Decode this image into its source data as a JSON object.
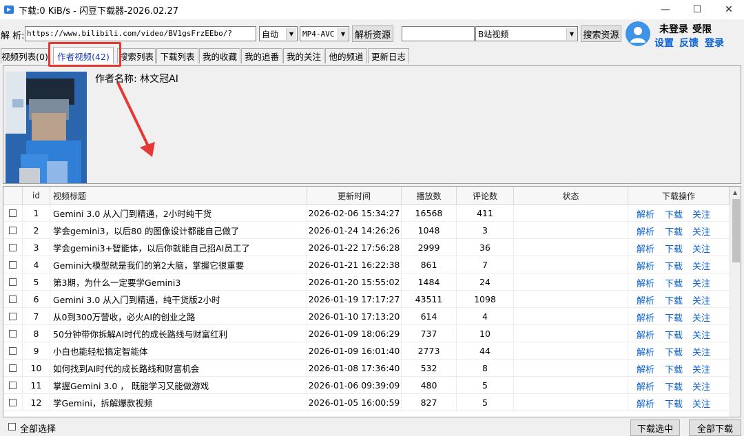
{
  "window": {
    "title": "下载:0 KiB/s - 闪豆下载器-2026.02.27",
    "minimize_glyph": "—",
    "maximize_glyph": "☐",
    "close_glyph": "✕"
  },
  "toolbar": {
    "parse_label": "解 析:",
    "url_value": "https://www.bilibili.com/video/BV1gsFrzEEbo/?",
    "quality_select": "自动",
    "format_select": "MP4-AVC",
    "parse_button": "解析资源",
    "search_value": "",
    "site_select": "B站视频",
    "search_button": "搜索资源"
  },
  "user": {
    "status": "未登录",
    "limit": "受限",
    "settings": "设置",
    "feedback": "反馈",
    "login": "登录"
  },
  "tabs": [
    {
      "label": "视频列表(0)"
    },
    {
      "label": "作者视频(42)"
    },
    {
      "label": "搜索列表"
    },
    {
      "label": "下载列表"
    },
    {
      "label": "我的收藏"
    },
    {
      "label": "我的追番"
    },
    {
      "label": "我的关注"
    },
    {
      "label": "他的频道"
    },
    {
      "label": "更新日志"
    }
  ],
  "author": {
    "label": "作者名称:",
    "name": "林文冠AI"
  },
  "table": {
    "headers": [
      "",
      "id",
      "视频标题",
      "更新时间",
      "播放数",
      "评论数",
      "状态",
      "下载操作"
    ],
    "actions": [
      "解析",
      "下载",
      "关注"
    ],
    "rows": [
      {
        "id": "1",
        "title": "Gemini 3.0 从入门到精通，2小时纯干货",
        "time": "2026-02-06 15:34:27",
        "plays": "16568",
        "comments": "411",
        "status": ""
      },
      {
        "id": "2",
        "title": "学会gemini3，以后80 的图像设计都能自己做了",
        "time": "2026-01-24 14:26:26",
        "plays": "1048",
        "comments": "3",
        "status": ""
      },
      {
        "id": "3",
        "title": "学会gemini3+智能体，以后你就能自己招AI员工了",
        "time": "2026-01-22 17:56:28",
        "plays": "2999",
        "comments": "36",
        "status": ""
      },
      {
        "id": "4",
        "title": "Gemini大模型就是我们的第2大脑，掌握它很重要",
        "time": "2026-01-21 16:22:38",
        "plays": "861",
        "comments": "7",
        "status": ""
      },
      {
        "id": "5",
        "title": "第3期，为什么一定要学Gemini3",
        "time": "2026-01-20 15:55:02",
        "plays": "1484",
        "comments": "24",
        "status": ""
      },
      {
        "id": "6",
        "title": "Gemini 3.0 从入门到精通，纯干货版2小时",
        "time": "2026-01-19 17:17:27",
        "plays": "43511",
        "comments": "1098",
        "status": ""
      },
      {
        "id": "7",
        "title": "从0到300万营收，必火AI的创业之路",
        "time": "2026-01-10 17:13:20",
        "plays": "614",
        "comments": "4",
        "status": ""
      },
      {
        "id": "8",
        "title": "50分钟带你拆解AI时代的成长路线与财富红利",
        "time": "2026-01-09 18:06:29",
        "plays": "737",
        "comments": "10",
        "status": ""
      },
      {
        "id": "9",
        "title": "小白也能轻松搞定智能体",
        "time": "2026-01-09 16:01:40",
        "plays": "2773",
        "comments": "44",
        "status": ""
      },
      {
        "id": "10",
        "title": "如何找到AI时代的成长路线和财富机会",
        "time": "2026-01-08 17:36:40",
        "plays": "532",
        "comments": "8",
        "status": ""
      },
      {
        "id": "11",
        "title": "掌握Gemini 3.0 ， 既能学习又能做游戏",
        "time": "2026-01-06 09:39:09",
        "plays": "480",
        "comments": "5",
        "status": ""
      },
      {
        "id": "12",
        "title": "学Gemini，拆解爆款视频",
        "time": "2026-01-05 16:00:59",
        "plays": "827",
        "comments": "5",
        "status": ""
      }
    ]
  },
  "footer": {
    "select_all": "全部选择",
    "download_selected": "下载选中",
    "download_all": "全部下载"
  }
}
